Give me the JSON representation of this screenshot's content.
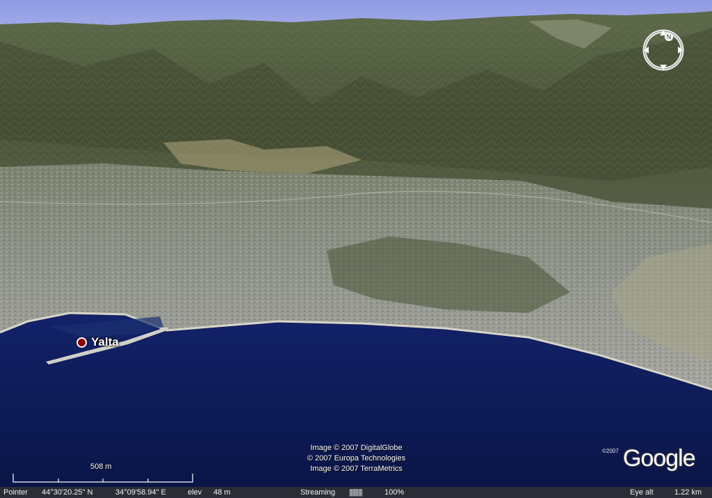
{
  "map": {
    "place": {
      "name": "Yalta"
    },
    "compass": {
      "north_letter": "N"
    },
    "attribution": [
      "Image © 2007 DigitalGlobe",
      "© 2007 Europa Technologies",
      "Image © 2007 TerraMetrics"
    ],
    "logo": {
      "copyright": "©2007",
      "text": "Google"
    },
    "scale": {
      "label": "508 m"
    },
    "colors": {
      "sky": "#9ba7e8",
      "sea": "#0d1d5c",
      "mountains": "#4f5a3c",
      "city": "#9aa09a",
      "status_bar": "#2a2d36"
    }
  },
  "status_bar": {
    "pointer_label": "Pointer",
    "latitude": "44°30'20.25\" N",
    "longitude": "34°09'58.94\" E",
    "elev_label": "elev",
    "elevation": "48 m",
    "streaming_label": "Streaming",
    "streaming_bar": "||||||||||",
    "streaming_percent": "100%",
    "eye_alt_label": "Eye alt",
    "eye_alt": "1.22 km"
  }
}
